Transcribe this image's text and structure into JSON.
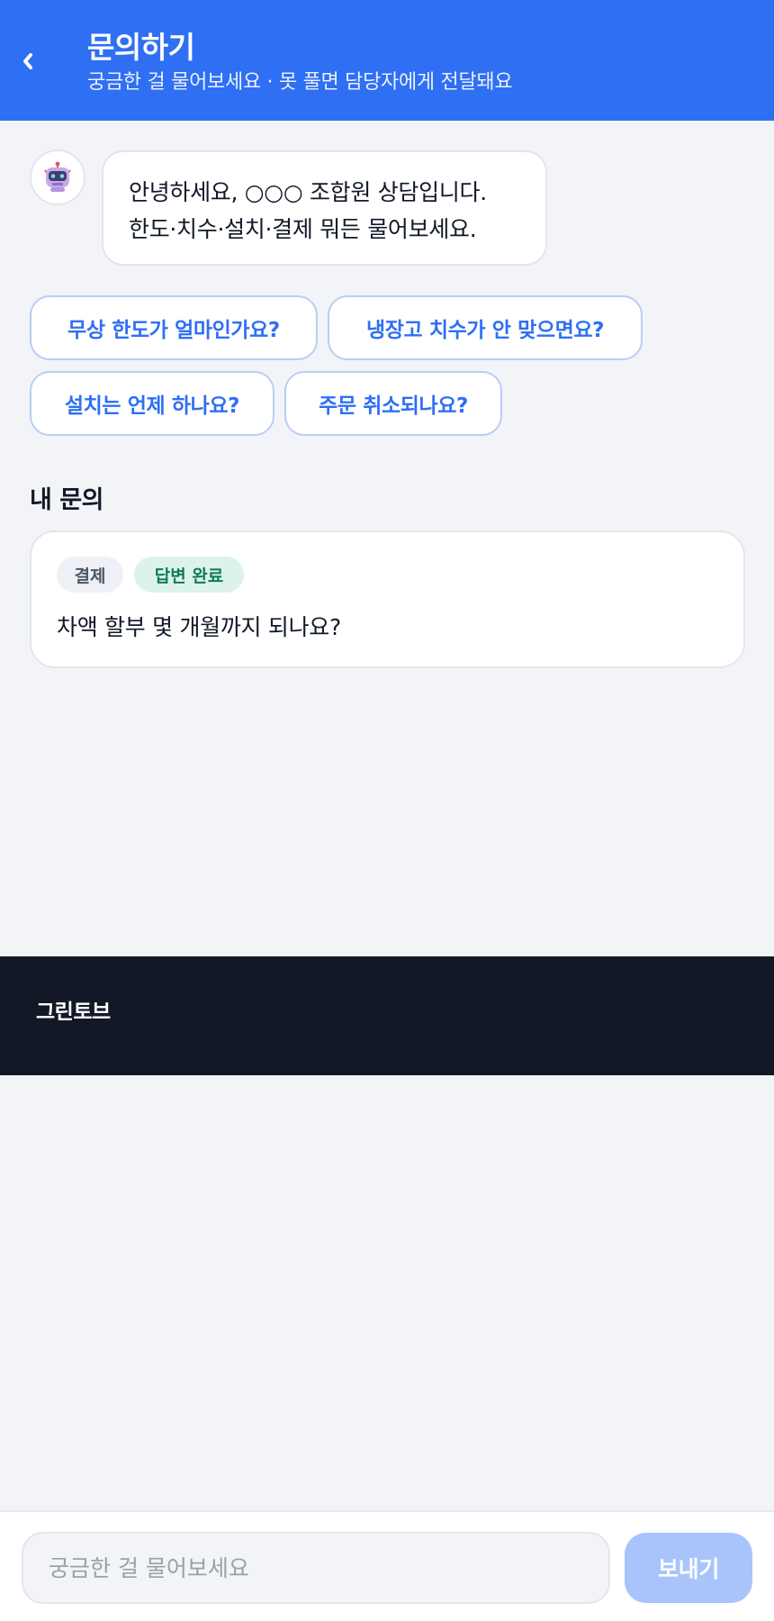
{
  "header": {
    "title": "문의하기",
    "subtitle": "궁금한 걸 물어보세요 · 못 풀면 담당자에게 전달돼요",
    "back_icon": "chevron-left-icon"
  },
  "bot": {
    "avatar_icon": "robot-icon",
    "greeting_lines": [
      "안녕하세요, ○○○ 조합원 상담입니다.",
      "한도·치수·설치·결제 뭐든 물어보세요."
    ]
  },
  "suggestions": [
    "무상 한도가 얼마인가요?",
    "냉장고 치수가 안 맞으면요?",
    "설치는 언제 하나요?",
    "주문 취소되나요?"
  ],
  "my_inquiries": {
    "title": "내 문의",
    "items": [
      {
        "category": "결제",
        "status": "답변 완료",
        "question": "차액 할부 몇 개월까지 되나요?"
      }
    ]
  },
  "footer": {
    "brand": "그린토브"
  },
  "composer": {
    "placeholder": "궁금한 걸 물어보세요",
    "value": "",
    "send_label": "보내기"
  },
  "colors": {
    "primary": "#2f6ff3",
    "send_disabled": "#a8c4fb",
    "status_done_bg": "#dcf3ec",
    "status_done_text": "#0f7a5c",
    "footer_bg": "#121826"
  }
}
